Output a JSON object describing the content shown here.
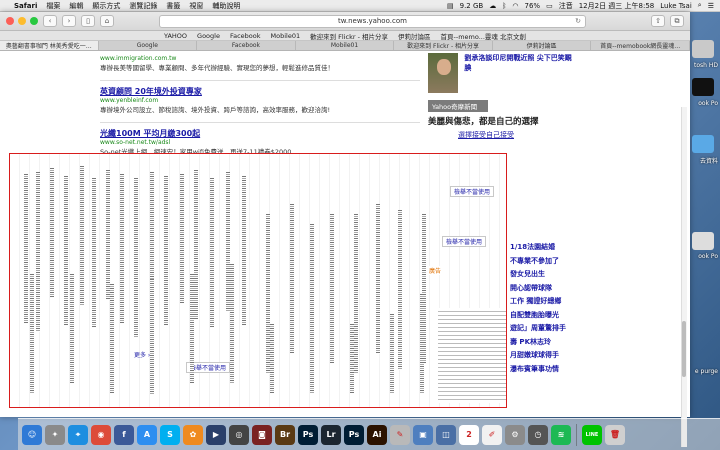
{
  "menubar": {
    "apple": "",
    "app": "Safari",
    "items": [
      "檔案",
      "編輯",
      "顯示方式",
      "瀏覽記錄",
      "書籤",
      "視窗",
      "輔助說明"
    ],
    "storage": "9.2 GB",
    "battery": "76%",
    "input_method": "注音",
    "datetime": "12月2日 週三 上午8:58",
    "user": "Luke Tsai"
  },
  "browser": {
    "url": "tw.news.yahoo.com",
    "bookmarks": [
      "YAHOO",
      "Google",
      "Facebook",
      "Mobile01",
      "歡迎來到 Flickr - 相片分享",
      "伊莉討論區",
      "首頁--memo...靈魂 北京文創"
    ],
    "tabs": [
      "奧藝翻書事咖門 林美秀愛吃一…",
      "Google",
      "Facebook",
      "Mobile01",
      "歡迎來到 Flickr - 相片分享",
      "伊莉討論區",
      "首頁--memobook網長靈魂…"
    ],
    "active_tab": 0
  },
  "ads": [
    {
      "url": "www.immigration.com.tw",
      "title": "",
      "desc": "專辦長美等國留學、專業顧問、多年代辦經驗、實現您的夢想，輕鬆進修品質佳！"
    },
    {
      "url": "www.yenbleinf.com",
      "title": "英資顧問 20年境外投資專家",
      "desc": "專辦境外公司設立、節稅諮詢、境外投資、跨戶等諮詢，高效率服務，歡迎洽詢!"
    },
    {
      "url": "www.so-net.net.tw/adsl",
      "title": "光纖100M 平均月繳300起",
      "desc": "So-net光纖上網，網速安！家用wifi免費送，再送7-11禮券$2000"
    }
  ],
  "sidebar": {
    "profile_text": "劉承洛談印尼開戰近照 尖下巴笑靦腆",
    "section_label": "Yahoo奇摩新聞",
    "headline": "美麗與傷悲，都是自己的選擇",
    "headline_sub": "選擇接受自己接受",
    "side_text": "許多雜誌我選擇不當解",
    "more": "更多 ›",
    "stories": [
      "1/18法園結婚",
      "不專業不參加了",
      "發女兒出生",
      "開心認帶球隊",
      "工作 獨證好總鄉",
      "自配雙胞胎曝光",
      "遊記」周董驚排手",
      "壽 PK林志玲",
      "月甜嫩球球得手",
      "瀑布賓筆事功情"
    ]
  },
  "glitch_labels": [
    "檢舉不當使用",
    "檢舉不當使用",
    "檢舉不當使用",
    "廣告"
  ],
  "desktop": {
    "items": [
      "tosh HD",
      "ook Po",
      "去資料",
      "ook Po",
      "e purge"
    ]
  },
  "dock": {
    "apps": [
      {
        "name": "Finder",
        "color": "#2f7ad6",
        "glyph": "☺"
      },
      {
        "name": "Launchpad",
        "color": "#8a8a8a",
        "glyph": "✦"
      },
      {
        "name": "Safari",
        "color": "#1d8ee0",
        "glyph": "⌖"
      },
      {
        "name": "Chrome",
        "color": "#dd4b39",
        "glyph": "◉"
      },
      {
        "name": "Facebook",
        "color": "#3b5998",
        "glyph": "f"
      },
      {
        "name": "App Store",
        "color": "#2d8ef0",
        "glyph": "A"
      },
      {
        "name": "Skype",
        "color": "#00aff0",
        "glyph": "S"
      },
      {
        "name": "Photos",
        "color": "#ef8a1f",
        "glyph": "✿"
      },
      {
        "name": "QuickTime",
        "color": "#2a3f6a",
        "glyph": "▶"
      },
      {
        "name": "Camera",
        "color": "#444444",
        "glyph": "◎"
      },
      {
        "name": "Photo Booth",
        "color": "#7a2222",
        "glyph": "◙"
      },
      {
        "name": "Bridge",
        "color": "#5a3a14",
        "glyph": "Br"
      },
      {
        "name": "Photoshop",
        "color": "#001d34",
        "glyph": "Ps"
      },
      {
        "name": "Lightroom",
        "color": "#1c2630",
        "glyph": "Lr"
      },
      {
        "name": "Photoshop",
        "color": "#001d34",
        "glyph": "Ps"
      },
      {
        "name": "Illustrator",
        "color": "#2b1200",
        "glyph": "Ai"
      },
      {
        "name": "Pencil",
        "color": "#b9b9b9",
        "glyph": "✎"
      },
      {
        "name": "Preview",
        "color": "#4e7fbf",
        "glyph": "▣"
      },
      {
        "name": "Finder2",
        "color": "#4a6fa5",
        "glyph": "◫"
      },
      {
        "name": "Calendar",
        "color": "#ffffff",
        "glyph": "2"
      },
      {
        "name": "TextEdit",
        "color": "#f1f1f1",
        "glyph": "✐"
      },
      {
        "name": "System Preferences",
        "color": "#8b8b8b",
        "glyph": "⚙"
      },
      {
        "name": "Time Machine",
        "color": "#555555",
        "glyph": "◷"
      },
      {
        "name": "Spotify",
        "color": "#1db954",
        "glyph": "≋"
      },
      {
        "name": "LINE",
        "color": "#00c300",
        "glyph": "LINE"
      },
      {
        "name": "Trash",
        "color": "#cfcfcf",
        "glyph": "🗑"
      }
    ]
  }
}
